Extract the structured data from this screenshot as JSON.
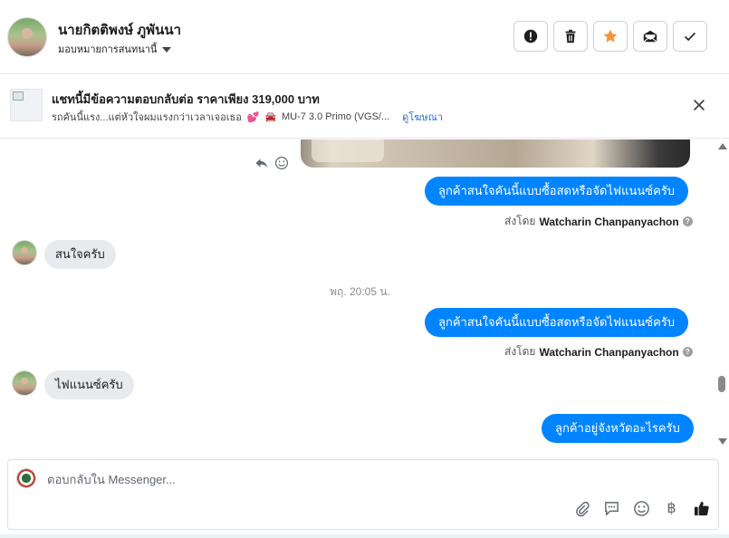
{
  "header": {
    "contact_name": "นายกิตติพงษ์ ภูพันนา",
    "assign_label": "มอบหมายการสนทนานี้",
    "actions": [
      {
        "name": "report-button",
        "icon": "alert-icon"
      },
      {
        "name": "delete-button",
        "icon": "trash-icon"
      },
      {
        "name": "star-button",
        "icon": "star-icon",
        "color": "#f7923b"
      },
      {
        "name": "mark-unread-button",
        "icon": "envelope-icon"
      },
      {
        "name": "mark-done-button",
        "icon": "check-icon"
      }
    ]
  },
  "ad": {
    "title": "แชทนี้มีข้อความตอบกลับต่อ ราคาเพียง 319,000 บาท",
    "subtitle": "รถคันนี้แรง...แต่หัวใจผมแรงกว่าเวลาเจอเธอ",
    "car_text": "MU-7 3.0 Primo (VGS/...",
    "link_label": "ดูโฆษณา"
  },
  "messages": {
    "out_1": "ลูกค้าสนใจคันนี้แบบซื้อสดหรือจัดไฟแนนซ์ครับ",
    "sent_by_prefix": "ส่งโดย",
    "agent_name": "Watcharin Chanpanyachon",
    "in_1": "สนใจครับ",
    "timestamp": "พฤ. 20:05 น.",
    "out_2": "ลูกค้าสนใจคันนี้แบบซื้อสดหรือจัดไฟแนนซ์ครับ",
    "in_2": "ไฟแนนซ์ครับ",
    "out_3": "ลูกค้าอยู่จังหวัดอะไรครับ"
  },
  "composer": {
    "placeholder": "ตอบกลับใน Messenger...",
    "baht_symbol": "฿"
  },
  "colors": {
    "accent": "#0084ff",
    "incoming_bubble": "#e9eaed",
    "star": "#f7923b"
  }
}
